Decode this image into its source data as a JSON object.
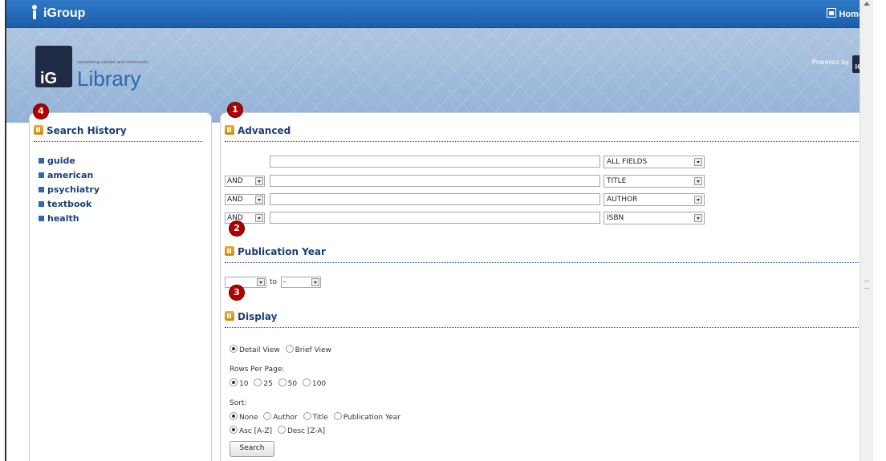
{
  "header": {
    "brand": "iGroup",
    "home_label": "Home"
  },
  "banner": {
    "logo_short": "iG",
    "logo_text": "Library",
    "tagline": "connecting content and community",
    "powered_by": "Powered by",
    "powered_logo": "iG"
  },
  "markers": [
    "1",
    "2",
    "3",
    "4"
  ],
  "history": {
    "title": "Search History",
    "items": [
      "guide",
      "american",
      "psychiatry",
      "textbook",
      "health"
    ]
  },
  "advanced": {
    "title": "Advanced",
    "rows": [
      {
        "operator": "",
        "value": "",
        "field": "ALL FIELDS"
      },
      {
        "operator": "AND",
        "value": "",
        "field": "TITLE"
      },
      {
        "operator": "AND",
        "value": "",
        "field": "AUTHOR"
      },
      {
        "operator": "AND",
        "value": "",
        "field": "ISBN"
      }
    ]
  },
  "pubyear": {
    "title": "Publication Year",
    "from": "",
    "to_label": "to",
    "to": "-"
  },
  "display": {
    "title": "Display",
    "view_options": [
      "Detail View",
      "Brief View"
    ],
    "view_selected": "Detail View",
    "rows_label": "Rows Per Page:",
    "rows_options": [
      "10",
      "25",
      "50",
      "100"
    ],
    "rows_selected": "10",
    "sort_label": "Sort:",
    "sort_options": [
      "None",
      "Author",
      "Title",
      "Publication Year"
    ],
    "sort_selected": "None",
    "order_options": [
      "Asc [A-Z]",
      "Desc [Z-A]"
    ],
    "order_selected": "Asc [A-Z]",
    "search_button": "Search"
  },
  "colors": {
    "topbar": "#1d5eaa",
    "heading": "#1d3f7a",
    "marker": "#b00000"
  }
}
